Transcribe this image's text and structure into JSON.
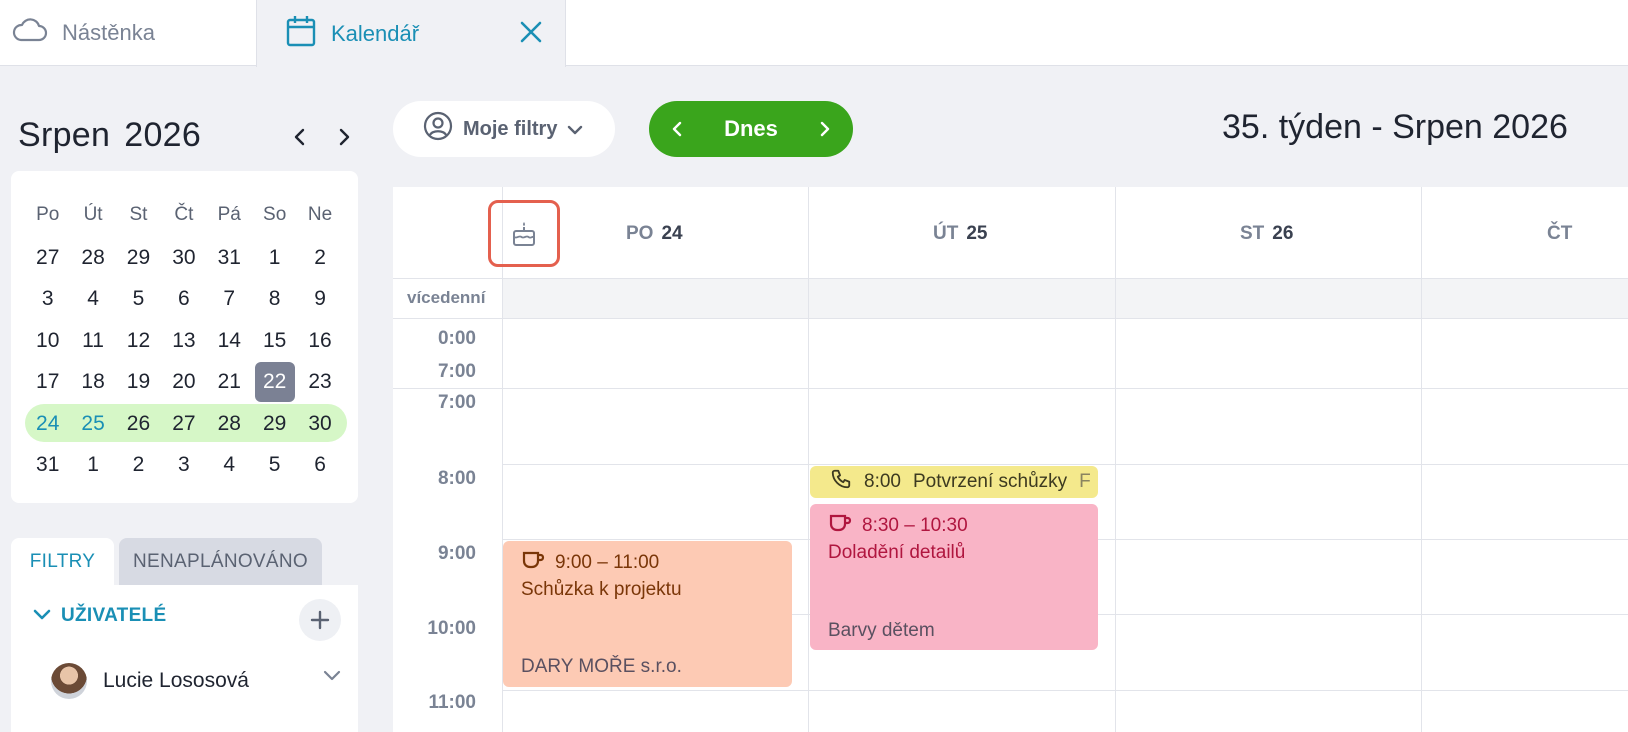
{
  "tabs": {
    "dashboard": "Nástěnka",
    "calendar": "Kalendář"
  },
  "mini_calendar": {
    "month": "Srpen",
    "year": "2026",
    "weekdays": [
      "Po",
      "Út",
      "St",
      "Čt",
      "Pá",
      "So",
      "Ne"
    ],
    "weeks": [
      [
        "27",
        "28",
        "29",
        "30",
        "31",
        "1",
        "2"
      ],
      [
        "3",
        "4",
        "5",
        "6",
        "7",
        "8",
        "9"
      ],
      [
        "10",
        "11",
        "12",
        "13",
        "14",
        "15",
        "16"
      ],
      [
        "17",
        "18",
        "19",
        "20",
        "21",
        "22",
        "23"
      ],
      [
        "24",
        "25",
        "26",
        "27",
        "28",
        "29",
        "30"
      ],
      [
        "31",
        "1",
        "2",
        "3",
        "4",
        "5",
        "6"
      ]
    ],
    "today": "22",
    "selected_week_index": 4,
    "highlighted_days": [
      "24",
      "25"
    ]
  },
  "filters": {
    "tab_filters": "FILTRY",
    "tab_unplanned": "NENAPLÁNOVÁNO",
    "users_header": "UŽIVATELÉ",
    "user_name": "Lucie Lososová"
  },
  "toolbar": {
    "my_filters": "Moje filtry",
    "today": "Dnes",
    "week_title": "35. týden - Srpen 2026"
  },
  "week": {
    "days": [
      {
        "abbr": "PO",
        "num": "24"
      },
      {
        "abbr": "ÚT",
        "num": "25"
      },
      {
        "abbr": "ST",
        "num": "26"
      },
      {
        "abbr": "ČT",
        "num": ""
      }
    ],
    "allday_label": "vícedenní",
    "time_labels": [
      "0:00",
      "7:00",
      "7:00",
      "8:00",
      "9:00",
      "10:00",
      "11:00"
    ]
  },
  "events": {
    "call": {
      "time": "8:00",
      "title": "Potvrzení schůzky",
      "extra": "F"
    },
    "pink": {
      "time": "8:30 – 10:30",
      "title": "Doladění detailů",
      "subtitle": "Barvy dětem"
    },
    "orange": {
      "time": "9:00 – 11:00",
      "title": "Schůzka k projektu",
      "subtitle": "DARY MOŘE s.r.o."
    }
  },
  "colors": {
    "accent": "#1a8fb5",
    "today_green": "#3aa51c",
    "week_highlight": "#d6f7c7",
    "event_call": "#f4e98c",
    "event_pink": "#f9b4c6",
    "event_orange": "#fdcab4",
    "birthday_box": "#e4604e"
  }
}
